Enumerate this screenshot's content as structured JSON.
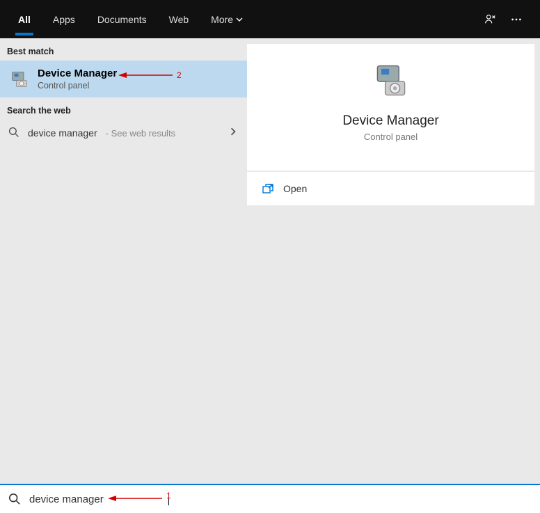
{
  "header": {
    "tabs": [
      {
        "label": "All",
        "active": true
      },
      {
        "label": "Apps",
        "active": false
      },
      {
        "label": "Documents",
        "active": false
      },
      {
        "label": "Web",
        "active": false
      },
      {
        "label": "More",
        "active": false,
        "hasDropdown": true
      }
    ]
  },
  "left": {
    "best_match_label": "Best match",
    "best_match": {
      "title": "Device Manager",
      "subtitle": "Control panel"
    },
    "search_web_label": "Search the web",
    "web_result": {
      "query": "device manager",
      "suffix": " - See web results"
    }
  },
  "detail": {
    "title": "Device Manager",
    "subtitle": "Control panel",
    "open_label": "Open"
  },
  "search": {
    "value": "device manager"
  },
  "annotations": {
    "step1": "1",
    "step2": "2"
  }
}
